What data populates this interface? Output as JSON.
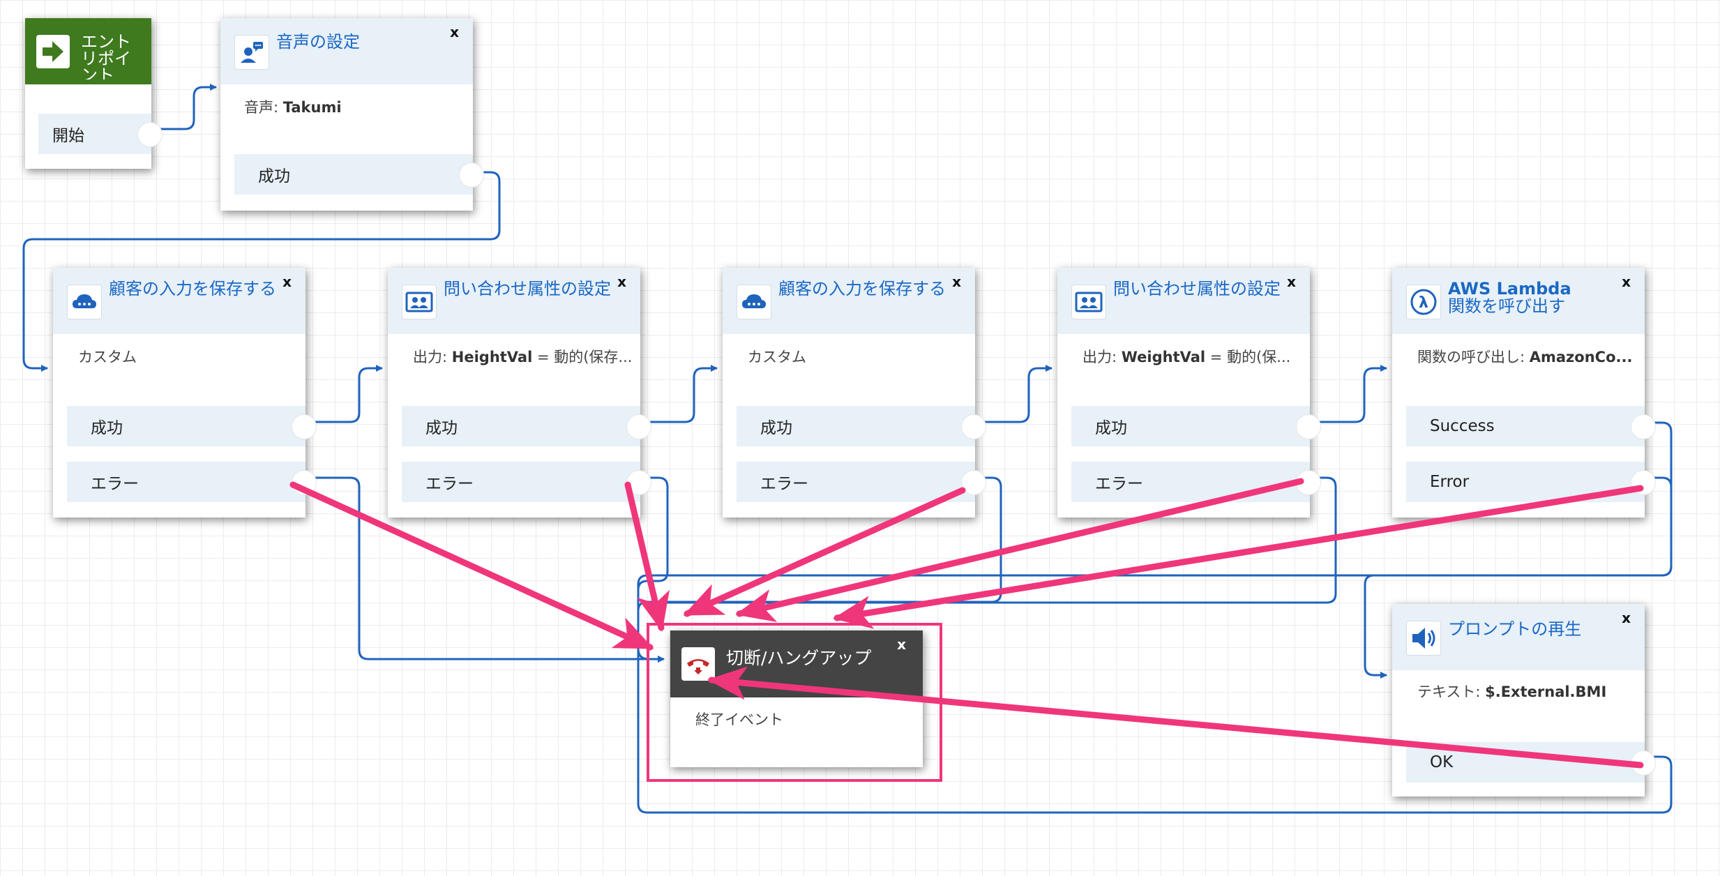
{
  "blocks": {
    "entry": {
      "title": "エントリポイント",
      "branch": "開始"
    },
    "voice": {
      "title": "音声の設定",
      "detail_label": "音声: ",
      "detail_value": "Takumi",
      "branch_success": "成功",
      "close": "x"
    },
    "store1": {
      "title": "顧客の入力を保存する",
      "detail_label": "カスタム",
      "branch_success": "成功",
      "branch_error": "エラー",
      "close": "x"
    },
    "setattr1": {
      "title": "問い合わせ属性の設定",
      "detail_label": "出力: ",
      "detail_value": "HeightVal",
      "detail_suffix": " = 動的(保存...",
      "branch_success": "成功",
      "branch_error": "エラー",
      "close": "x"
    },
    "store2": {
      "title": "顧客の入力を保存する",
      "detail_label": "カスタム",
      "branch_success": "成功",
      "branch_error": "エラー",
      "close": "x"
    },
    "setattr2": {
      "title": "問い合わせ属性の設定",
      "detail_label": "出力: ",
      "detail_value": "WeightVal",
      "detail_suffix": " = 動的(保...",
      "branch_success": "成功",
      "branch_error": "エラー",
      "close": "x"
    },
    "lambda": {
      "title_line1": "AWS Lambda",
      "title_line2": "関数を呼び出す",
      "detail_label": "関数の呼び出し: ",
      "detail_value": "AmazonCo...",
      "branch_success": "Success",
      "branch_error": "Error",
      "close": "x"
    },
    "hangup": {
      "title": "切断/ハングアップ",
      "detail_label": "終了イベント",
      "close": "x"
    },
    "prompt": {
      "title": "プロンプトの再生",
      "detail_label": "テキスト: ",
      "detail_value": "$.External.BMI",
      "branch_ok": "OK",
      "close": "x"
    }
  },
  "colors": {
    "connector": "#1f63bd",
    "annotation": "#f0367a",
    "title_blue": "#1a68c4",
    "header_bg": "#e8f0f8",
    "entry_bg": "#3f7a1e",
    "hangup_bg": "#444444"
  },
  "icons": {
    "entry": "arrow-right-icon",
    "voice": "person-speech-icon",
    "store": "cloud-icon",
    "setattr": "people-card-icon",
    "lambda": "lambda-icon",
    "hangup": "phone-hangup-icon",
    "prompt": "speaker-icon"
  }
}
